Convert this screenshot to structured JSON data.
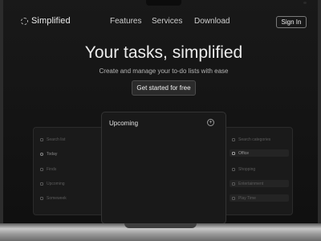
{
  "header": {
    "brand": "Simplified",
    "nav": [
      "Features",
      "Services",
      "Download"
    ],
    "signin_label": "Sign In"
  },
  "hero": {
    "title": "Your tasks, simplified",
    "subtitle": "Create and manage your to-do lists with ease",
    "cta_label": "Get started for free"
  },
  "left_panel": {
    "items": [
      "Search list",
      "Today",
      "Finds",
      "Upcoming",
      "Someweek"
    ],
    "active_index": 1
  },
  "center_panel": {
    "title": "Upcoming",
    "add_icon": "plus-circle-icon"
  },
  "right_panel": {
    "search_placeholder": "Search categories",
    "items": [
      "Office",
      "Shopping",
      "Entertainment",
      "Play Time"
    ],
    "active_index": 0
  },
  "colors": {
    "background": "#141414",
    "text": "#ececec",
    "panel": "#1a1a1a"
  }
}
